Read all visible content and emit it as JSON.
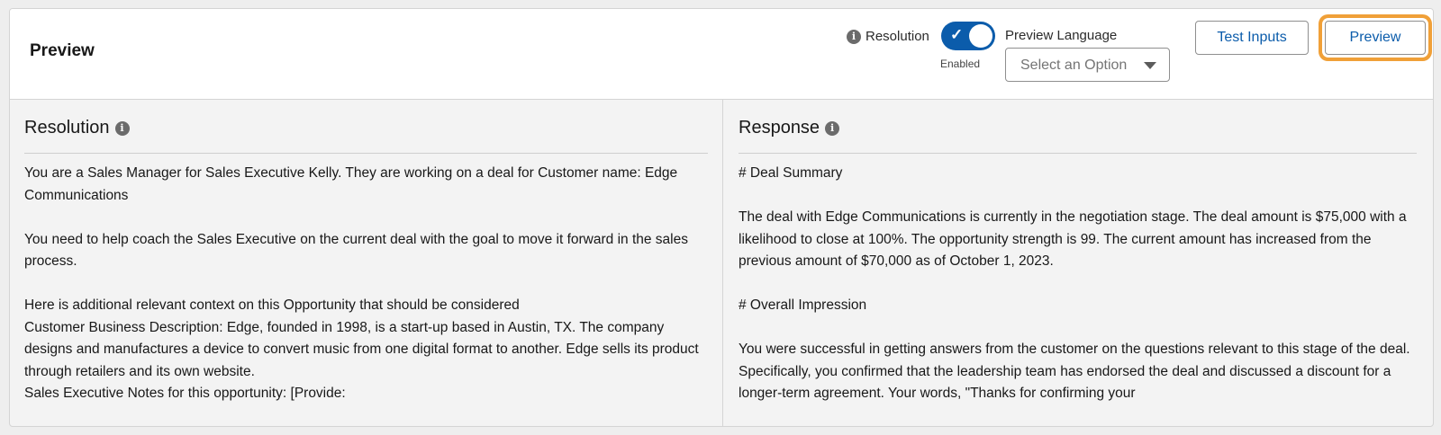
{
  "header": {
    "title": "Preview",
    "resolution_label": "Resolution",
    "toggle_state": "Enabled",
    "preview_language_label": "Preview Language",
    "select_placeholder": "Select an Option",
    "test_inputs_label": "Test Inputs",
    "preview_label": "Preview"
  },
  "resolution_panel": {
    "title": "Resolution",
    "paragraphs": {
      "p1": "You are a Sales Manager for Sales Executive Kelly. They are working on a deal for Customer name: Edge Communications",
      "p2": "You need to help coach the Sales Executive on the current deal with the goal to move it forward in the sales process.",
      "p3": "Here is additional relevant context on this Opportunity that should be considered",
      "p4": "Customer Business Description: Edge, founded in 1998, is a start-up based in Austin, TX. The company designs and manufactures a device to convert music from one digital format to another. Edge sells its product through retailers and its own website.",
      "p5": "Sales Executive Notes for this opportunity: [Provide:"
    }
  },
  "response_panel": {
    "title": "Response",
    "paragraphs": {
      "p1": "# Deal Summary",
      "p2": "The deal with Edge Communications is currently in the negotiation stage. The deal amount is $75,000 with a likelihood to close at 100%. The opportunity strength is 99. The current amount has increased from the previous amount of $70,000 as of October 1, 2023.",
      "p3": "# Overall Impression",
      "p4": "You were successful in getting answers from the customer on the questions relevant to this stage of the deal. Specifically, you confirmed that the leadership team has endorsed the deal and discussed a discount for a longer-term agreement. Your words, \"Thanks for confirming your"
    }
  },
  "icons": {
    "info": "info-icon",
    "toggle_check": "check-icon",
    "select_caret": "chevron-down-icon"
  },
  "colors": {
    "brand_blue": "#0b5cab",
    "focus_ring": "#f0a038"
  }
}
